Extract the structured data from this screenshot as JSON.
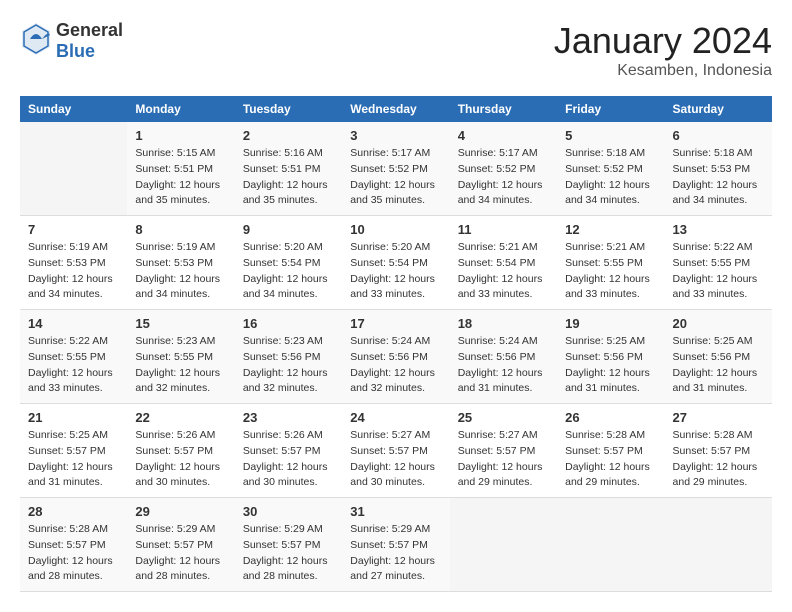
{
  "logo": {
    "general": "General",
    "blue": "Blue"
  },
  "header": {
    "month": "January 2024",
    "location": "Kesamben, Indonesia"
  },
  "weekdays": [
    "Sunday",
    "Monday",
    "Tuesday",
    "Wednesday",
    "Thursday",
    "Friday",
    "Saturday"
  ],
  "weeks": [
    [
      {
        "day": "",
        "sunrise": "",
        "sunset": "",
        "daylight": ""
      },
      {
        "day": "1",
        "sunrise": "Sunrise: 5:15 AM",
        "sunset": "Sunset: 5:51 PM",
        "daylight": "Daylight: 12 hours and 35 minutes."
      },
      {
        "day": "2",
        "sunrise": "Sunrise: 5:16 AM",
        "sunset": "Sunset: 5:51 PM",
        "daylight": "Daylight: 12 hours and 35 minutes."
      },
      {
        "day": "3",
        "sunrise": "Sunrise: 5:17 AM",
        "sunset": "Sunset: 5:52 PM",
        "daylight": "Daylight: 12 hours and 35 minutes."
      },
      {
        "day": "4",
        "sunrise": "Sunrise: 5:17 AM",
        "sunset": "Sunset: 5:52 PM",
        "daylight": "Daylight: 12 hours and 34 minutes."
      },
      {
        "day": "5",
        "sunrise": "Sunrise: 5:18 AM",
        "sunset": "Sunset: 5:52 PM",
        "daylight": "Daylight: 12 hours and 34 minutes."
      },
      {
        "day": "6",
        "sunrise": "Sunrise: 5:18 AM",
        "sunset": "Sunset: 5:53 PM",
        "daylight": "Daylight: 12 hours and 34 minutes."
      }
    ],
    [
      {
        "day": "7",
        "sunrise": "Sunrise: 5:19 AM",
        "sunset": "Sunset: 5:53 PM",
        "daylight": "Daylight: 12 hours and 34 minutes."
      },
      {
        "day": "8",
        "sunrise": "Sunrise: 5:19 AM",
        "sunset": "Sunset: 5:53 PM",
        "daylight": "Daylight: 12 hours and 34 minutes."
      },
      {
        "day": "9",
        "sunrise": "Sunrise: 5:20 AM",
        "sunset": "Sunset: 5:54 PM",
        "daylight": "Daylight: 12 hours and 34 minutes."
      },
      {
        "day": "10",
        "sunrise": "Sunrise: 5:20 AM",
        "sunset": "Sunset: 5:54 PM",
        "daylight": "Daylight: 12 hours and 33 minutes."
      },
      {
        "day": "11",
        "sunrise": "Sunrise: 5:21 AM",
        "sunset": "Sunset: 5:54 PM",
        "daylight": "Daylight: 12 hours and 33 minutes."
      },
      {
        "day": "12",
        "sunrise": "Sunrise: 5:21 AM",
        "sunset": "Sunset: 5:55 PM",
        "daylight": "Daylight: 12 hours and 33 minutes."
      },
      {
        "day": "13",
        "sunrise": "Sunrise: 5:22 AM",
        "sunset": "Sunset: 5:55 PM",
        "daylight": "Daylight: 12 hours and 33 minutes."
      }
    ],
    [
      {
        "day": "14",
        "sunrise": "Sunrise: 5:22 AM",
        "sunset": "Sunset: 5:55 PM",
        "daylight": "Daylight: 12 hours and 33 minutes."
      },
      {
        "day": "15",
        "sunrise": "Sunrise: 5:23 AM",
        "sunset": "Sunset: 5:55 PM",
        "daylight": "Daylight: 12 hours and 32 minutes."
      },
      {
        "day": "16",
        "sunrise": "Sunrise: 5:23 AM",
        "sunset": "Sunset: 5:56 PM",
        "daylight": "Daylight: 12 hours and 32 minutes."
      },
      {
        "day": "17",
        "sunrise": "Sunrise: 5:24 AM",
        "sunset": "Sunset: 5:56 PM",
        "daylight": "Daylight: 12 hours and 32 minutes."
      },
      {
        "day": "18",
        "sunrise": "Sunrise: 5:24 AM",
        "sunset": "Sunset: 5:56 PM",
        "daylight": "Daylight: 12 hours and 31 minutes."
      },
      {
        "day": "19",
        "sunrise": "Sunrise: 5:25 AM",
        "sunset": "Sunset: 5:56 PM",
        "daylight": "Daylight: 12 hours and 31 minutes."
      },
      {
        "day": "20",
        "sunrise": "Sunrise: 5:25 AM",
        "sunset": "Sunset: 5:56 PM",
        "daylight": "Daylight: 12 hours and 31 minutes."
      }
    ],
    [
      {
        "day": "21",
        "sunrise": "Sunrise: 5:25 AM",
        "sunset": "Sunset: 5:57 PM",
        "daylight": "Daylight: 12 hours and 31 minutes."
      },
      {
        "day": "22",
        "sunrise": "Sunrise: 5:26 AM",
        "sunset": "Sunset: 5:57 PM",
        "daylight": "Daylight: 12 hours and 30 minutes."
      },
      {
        "day": "23",
        "sunrise": "Sunrise: 5:26 AM",
        "sunset": "Sunset: 5:57 PM",
        "daylight": "Daylight: 12 hours and 30 minutes."
      },
      {
        "day": "24",
        "sunrise": "Sunrise: 5:27 AM",
        "sunset": "Sunset: 5:57 PM",
        "daylight": "Daylight: 12 hours and 30 minutes."
      },
      {
        "day": "25",
        "sunrise": "Sunrise: 5:27 AM",
        "sunset": "Sunset: 5:57 PM",
        "daylight": "Daylight: 12 hours and 29 minutes."
      },
      {
        "day": "26",
        "sunrise": "Sunrise: 5:28 AM",
        "sunset": "Sunset: 5:57 PM",
        "daylight": "Daylight: 12 hours and 29 minutes."
      },
      {
        "day": "27",
        "sunrise": "Sunrise: 5:28 AM",
        "sunset": "Sunset: 5:57 PM",
        "daylight": "Daylight: 12 hours and 29 minutes."
      }
    ],
    [
      {
        "day": "28",
        "sunrise": "Sunrise: 5:28 AM",
        "sunset": "Sunset: 5:57 PM",
        "daylight": "Daylight: 12 hours and 28 minutes."
      },
      {
        "day": "29",
        "sunrise": "Sunrise: 5:29 AM",
        "sunset": "Sunset: 5:57 PM",
        "daylight": "Daylight: 12 hours and 28 minutes."
      },
      {
        "day": "30",
        "sunrise": "Sunrise: 5:29 AM",
        "sunset": "Sunset: 5:57 PM",
        "daylight": "Daylight: 12 hours and 28 minutes."
      },
      {
        "day": "31",
        "sunrise": "Sunrise: 5:29 AM",
        "sunset": "Sunset: 5:57 PM",
        "daylight": "Daylight: 12 hours and 27 minutes."
      },
      {
        "day": "",
        "sunrise": "",
        "sunset": "",
        "daylight": ""
      },
      {
        "day": "",
        "sunrise": "",
        "sunset": "",
        "daylight": ""
      },
      {
        "day": "",
        "sunrise": "",
        "sunset": "",
        "daylight": ""
      }
    ]
  ]
}
